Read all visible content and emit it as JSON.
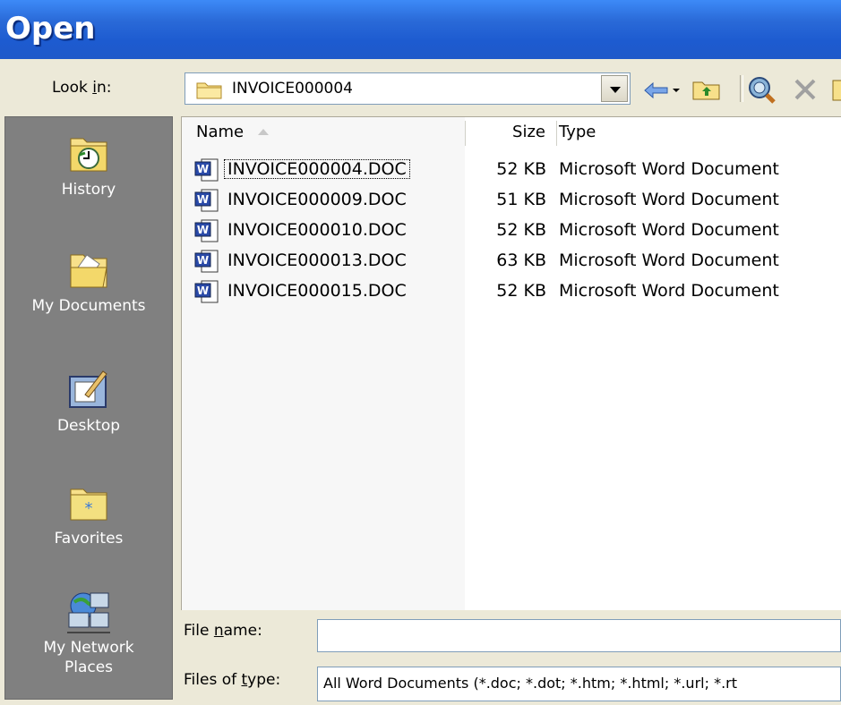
{
  "dialog": {
    "title": "Open"
  },
  "lookin": {
    "label": "Look in:",
    "label_pre": "Look ",
    "label_key": "i",
    "label_post": "n:",
    "value": "INVOICE000004"
  },
  "places": [
    {
      "label": "History",
      "icon": "history-icon"
    },
    {
      "label": "My Documents",
      "icon": "my-documents-icon"
    },
    {
      "label": "Desktop",
      "icon": "desktop-icon"
    },
    {
      "label": "Favorites",
      "icon": "favorites-icon"
    },
    {
      "label_line1": "My Network",
      "label_line2": "Places",
      "icon": "network-places-icon"
    }
  ],
  "columns": {
    "name": "Name",
    "size": "Size",
    "type": "Type"
  },
  "files": [
    {
      "name": "INVOICE000004.DOC",
      "size": "52 KB",
      "type": "Microsoft Word Document"
    },
    {
      "name": "INVOICE000009.DOC",
      "size": "51 KB",
      "type": "Microsoft Word Document"
    },
    {
      "name": "INVOICE000010.DOC",
      "size": "52 KB",
      "type": "Microsoft Word Document"
    },
    {
      "name": "INVOICE000013.DOC",
      "size": "63 KB",
      "type": "Microsoft Word Document"
    },
    {
      "name": "INVOICE000015.DOC",
      "size": "52 KB",
      "type": "Microsoft Word Document"
    }
  ],
  "filename": {
    "label_pre": "File ",
    "label_key": "n",
    "label_post": "ame:",
    "value": ""
  },
  "filetype": {
    "label_pre": "Files of ",
    "label_key": "t",
    "label_post": "ype:",
    "value": "All Word Documents (*.doc; *.dot; *.htm; *.html; *.url; *.rt"
  },
  "colors": {
    "title_bar": "#2a6ad8",
    "places_bar": "#808080",
    "dialog_bg": "#ece9d8"
  }
}
